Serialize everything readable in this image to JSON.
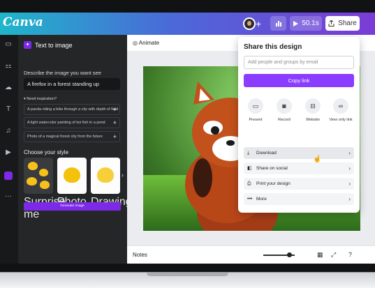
{
  "app": {
    "logo": "Canva"
  },
  "topbar": {
    "add_icon": "plus-icon",
    "analytics_icon": "bar-chart-icon",
    "present": {
      "icon": "play-icon",
      "label": "50.1s"
    },
    "share": {
      "icon": "share-icon",
      "label": "Share"
    },
    "colors": {
      "gradient_start": "#1fb6c9",
      "gradient_end": "#7c3bd6"
    }
  },
  "rail": {
    "items": [
      "layout-icon",
      "elements-icon",
      "upload-icon",
      "text-icon",
      "audio-icon",
      "video-icon",
      "apps-icon",
      "more-icon"
    ]
  },
  "panel": {
    "title": "Text to image",
    "describe_label": "Describe the image you want see",
    "describe_value": "A firefox in a forest standing up",
    "inspiration_label": "Need inspiration?",
    "suggestions": [
      "A panda riding a bike through a city with depth of field",
      "A light watercolor painting of koi fish in a pond",
      "Photo of a magical forest city from the future"
    ],
    "choose_style": "Choose your style",
    "styles": [
      "Surprise me",
      "Photo",
      "Drawing"
    ],
    "generate": "Generate image"
  },
  "canvas": {
    "animate": "Animate",
    "notes": "Notes",
    "zoom_level": 0.78
  },
  "share_menu": {
    "title": "Share this design",
    "people_placeholder": "Add people and groups by email",
    "copy_link": "Copy link",
    "options": [
      {
        "icon": "present-icon",
        "label": "Present"
      },
      {
        "icon": "record-icon",
        "label": "Record"
      },
      {
        "icon": "website-icon",
        "label": "Website"
      },
      {
        "icon": "link-icon",
        "label": "View only link"
      }
    ],
    "rows": [
      {
        "icon": "download-icon",
        "label": "Download"
      },
      {
        "icon": "social-icon",
        "label": "Share on social"
      },
      {
        "icon": "print-icon",
        "label": "Print your design"
      },
      {
        "icon": "more-icon",
        "label": "More"
      }
    ],
    "accent": "#8b3dff"
  }
}
